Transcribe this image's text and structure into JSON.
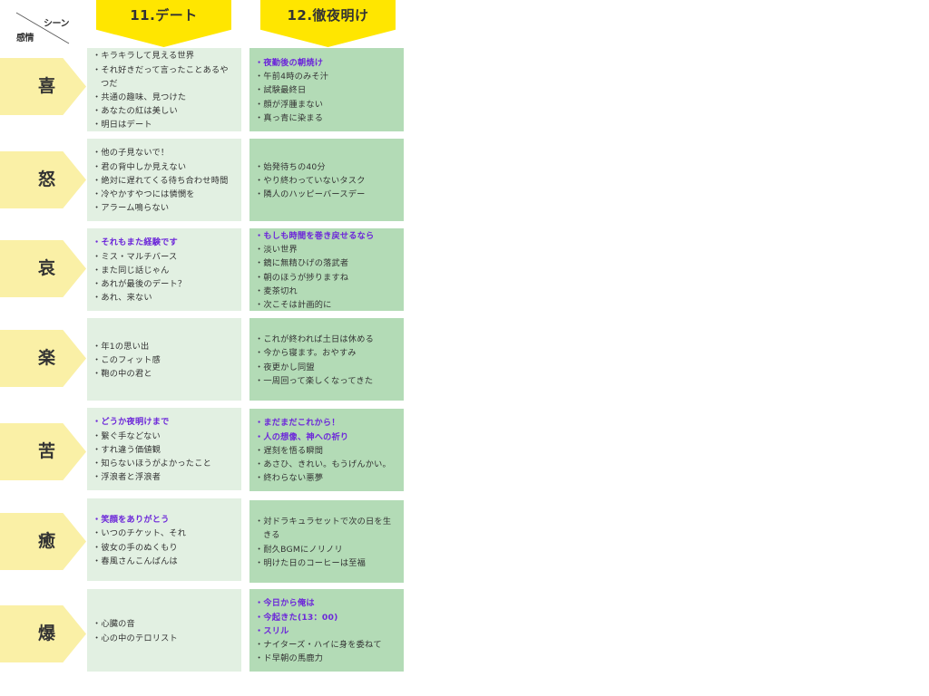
{
  "corner": {
    "scene": "シーン",
    "emotion": "感情"
  },
  "scenes": [
    {
      "label": "11.デート"
    },
    {
      "label": "12.徹夜明け"
    }
  ],
  "rows": [
    {
      "emotion": "喜",
      "cells": [
        [
          {
            "text": "キラキラして見える世界"
          },
          {
            "text": "それ好きだって言ったことあるやつだ",
            "wrap": true
          },
          {
            "text": "共通の趣味、見つけた"
          },
          {
            "text": "あなたの紅は美しい"
          },
          {
            "text": "明日はデート"
          }
        ],
        [
          {
            "text": "夜勤後の朝焼け",
            "hl": true
          },
          {
            "text": "午前4時のみそ汁"
          },
          {
            "text": "試験最終日"
          },
          {
            "text": "顔が浮腫まない"
          },
          {
            "text": "真っ青に染まる"
          }
        ]
      ]
    },
    {
      "emotion": "怒",
      "cells": [
        [
          {
            "text": "他の子見ないで！"
          },
          {
            "text": "君の背中しか見えない"
          },
          {
            "text": "絶対に遅れてくる待ち合わせ時間"
          },
          {
            "text": "冷やかすやつには憐憫を"
          },
          {
            "text": "アラーム鳴らない"
          }
        ],
        [
          {
            "text": "始発待ちの40分"
          },
          {
            "text": "やり終わっていないタスク"
          },
          {
            "text": "隣人のハッピーバースデー"
          }
        ]
      ]
    },
    {
      "emotion": "哀",
      "cells": [
        [
          {
            "text": "それもまた経験です",
            "hl": true
          },
          {
            "text": "ミス・マルチバース"
          },
          {
            "text": "また同じ話じゃん"
          },
          {
            "text": "あれが最後のデート？"
          },
          {
            "text": "あれ、来ない"
          }
        ],
        [
          {
            "text": "もしも時間を巻き戻せるなら",
            "hl": true
          },
          {
            "text": "淡い世界"
          },
          {
            "text": "鏡に無精ひげの落武者"
          },
          {
            "text": "朝のほうが捗りますね"
          },
          {
            "text": "麦茶切れ"
          },
          {
            "text": "次こそは計画的に"
          }
        ]
      ]
    },
    {
      "emotion": "楽",
      "cells": [
        [
          {
            "text": "年1の思い出"
          },
          {
            "text": "このフィット感"
          },
          {
            "text": "鞄の中の君と"
          }
        ],
        [
          {
            "text": "これが終われば土日は休める"
          },
          {
            "text": "今から寝ます。おやすみ"
          },
          {
            "text": "夜更かし同盟"
          },
          {
            "text": "一周回って楽しくなってきた"
          }
        ]
      ]
    },
    {
      "emotion": "苦",
      "cells": [
        [
          {
            "text": "どうか夜明けまで",
            "hl": true
          },
          {
            "text": "繋ぐ手などない"
          },
          {
            "text": "すれ違う価値観"
          },
          {
            "text": "知らないほうがよかったこと"
          },
          {
            "text": "浮浪者と浮浪者"
          }
        ],
        [
          {
            "text": "まだまだこれから！",
            "hl": true
          },
          {
            "text": "人の想像、神への祈り",
            "hl": true
          },
          {
            "text": "遅刻を悟る瞬間"
          },
          {
            "text": "あさひ、きれい。もうげんかい。"
          },
          {
            "text": "終わらない悪夢"
          }
        ]
      ]
    },
    {
      "emotion": "癒",
      "cells": [
        [
          {
            "text": "笑顔をありがとう",
            "hl": true
          },
          {
            "text": "いつのチケット、それ"
          },
          {
            "text": "彼女の手のぬくもり"
          },
          {
            "text": "春風さんこんばんは"
          }
        ],
        [
          {
            "text": "対ドラキュラセットで次の日を生きる",
            "wrap": true
          },
          {
            "text": "耐久BGMにノリノリ"
          },
          {
            "text": "明けた日のコーヒーは至福"
          }
        ]
      ]
    },
    {
      "emotion": "爆",
      "cells": [
        [
          {
            "text": "心臓の音"
          },
          {
            "text": "心の中のテロリスト"
          }
        ],
        [
          {
            "text": "今日から俺は",
            "hl": true
          },
          {
            "text": "今起きた(13：00)",
            "hl": true
          },
          {
            "text": "スリル",
            "hl": true
          },
          {
            "text": "ナイターズ・ハイに身を委ねて"
          },
          {
            "text": "ド早朝の馬鹿力"
          }
        ]
      ]
    }
  ]
}
